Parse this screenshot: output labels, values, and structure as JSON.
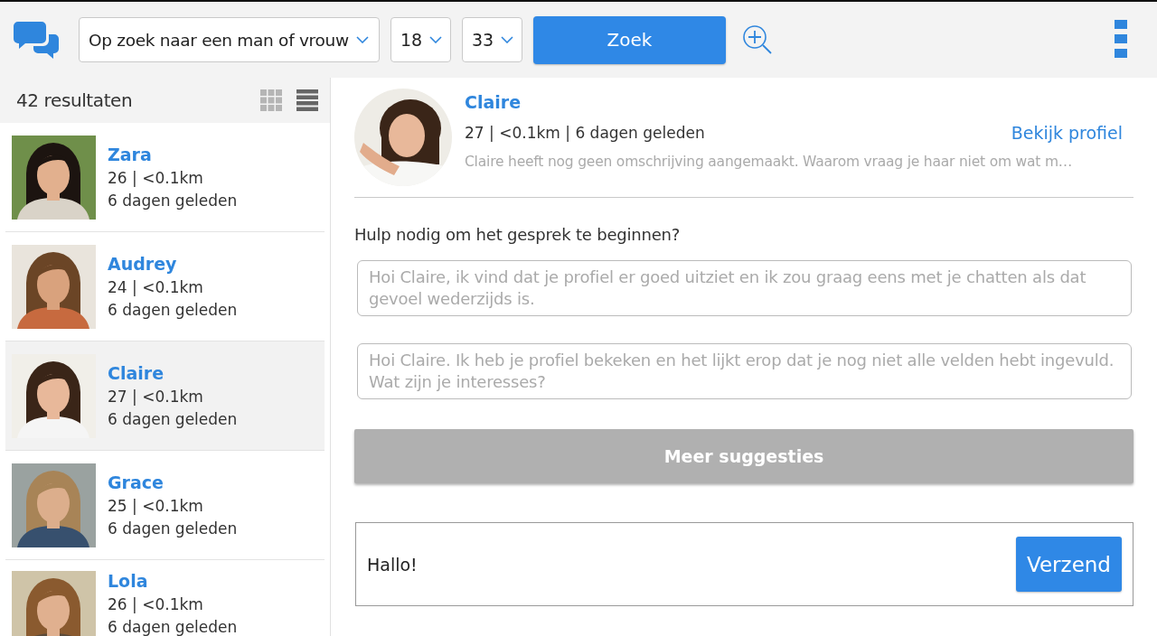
{
  "header": {
    "search_type": "Op zoek naar een man of vrouw",
    "age_min": "18",
    "age_max": "33",
    "search_button": "Zoek"
  },
  "results": {
    "count": "42 resultaten",
    "views": [
      {
        "kind": "grid",
        "selected": false
      },
      {
        "kind": "list",
        "selected": true
      }
    ],
    "items": [
      {
        "name": "Zara",
        "info": "26 | <0.1km",
        "last_seen": "6 dagen geleden",
        "selected": false
      },
      {
        "name": "Audrey",
        "info": "24 | <0.1km",
        "last_seen": "6 dagen geleden",
        "selected": false
      },
      {
        "name": "Claire",
        "info": "27 | <0.1km",
        "last_seen": "6 dagen geleden",
        "selected": true
      },
      {
        "name": "Grace",
        "info": "25 | <0.1km",
        "last_seen": "6 dagen geleden",
        "selected": false
      },
      {
        "name": "Lola",
        "info": "26 | <0.1km",
        "last_seen": "6 dagen geleden",
        "selected": false
      }
    ]
  },
  "profile": {
    "name": "Claire",
    "info": "27 | <0.1km | 6 dagen geleden",
    "link": "Bekijk profiel",
    "description": "Claire heeft nog geen omschrijving aangemaakt. Waarom vraag je haar niet om wat m…"
  },
  "suggestions": {
    "title": "Hulp nodig om het gesprek te beginnen?",
    "items": [
      "Hoi Claire, ik vind dat je profiel er goed uitziet en ik zou graag eens met je chatten als dat gevoel wederzijds is.",
      "Hoi Claire. Ik heb je profiel bekeken en het lijkt erop dat je nog niet alle velden hebt ingevuld. Wat zijn je interesses?"
    ],
    "more_button": "Meer suggesties"
  },
  "message": {
    "value": "Hallo!",
    "send_button": "Verzend"
  }
}
